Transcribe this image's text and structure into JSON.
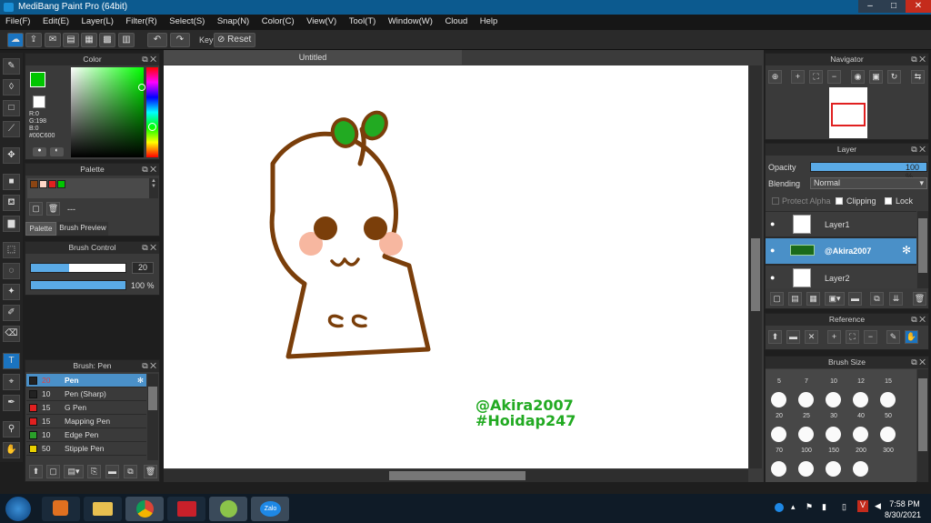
{
  "window": {
    "title": "MediBang Paint Pro (64bit)",
    "minimize": "–",
    "maximize": "□",
    "close": "✕"
  },
  "menu": [
    "File(F)",
    "Edit(E)",
    "Layer(L)",
    "Filter(R)",
    "Select(S)",
    "Snap(N)",
    "Color(C)",
    "View(V)",
    "Tool(T)",
    "Window(W)",
    "Cloud",
    "Help"
  ],
  "toolbar": {
    "key_label": "Key",
    "reset_label": "Reset"
  },
  "color_panel": {
    "title": "Color",
    "r": "R:0",
    "g": "G:198",
    "b": "B:0",
    "hex": "#00C600",
    "current": "#00c600"
  },
  "palette_panel": {
    "title": "Palette",
    "colors": [
      "#8b4513",
      "#ffd7c7",
      "#e02020",
      "#00c600"
    ],
    "entry": "---",
    "tab_palette": "Palette",
    "tab_preview": "Brush Preview"
  },
  "brush_control": {
    "title": "Brush Control",
    "size": "20",
    "opacity": "100 %",
    "size_fraction": 0.4,
    "opacity_fraction": 1.0
  },
  "brush_list": {
    "title": "Brush: Pen",
    "items": [
      {
        "size": "20",
        "name": "Pen",
        "color": "#222222",
        "selected": true
      },
      {
        "size": "10",
        "name": "Pen (Sharp)",
        "color": "#222222"
      },
      {
        "size": "15",
        "name": "G Pen",
        "color": "#e02020"
      },
      {
        "size": "15",
        "name": "Mapping Pen",
        "color": "#e02020"
      },
      {
        "size": "10",
        "name": "Edge Pen",
        "color": "#2aa02a"
      },
      {
        "size": "50",
        "name": "Stipple Pen",
        "color": "#e8d000"
      }
    ]
  },
  "document": {
    "tab": "Untitled",
    "watermark_1": "@Akira2007",
    "watermark_2": "#Hoidap247"
  },
  "navigator": {
    "title": "Navigator"
  },
  "layer_panel": {
    "title": "Layer",
    "opacity_label": "Opacity",
    "opacity_value": "100 %",
    "blending_label": "Blending",
    "blending_value": "Normal",
    "protect_alpha": "Protect Alpha",
    "clipping": "Clipping",
    "lock": "Lock",
    "layers": [
      {
        "name": "Layer1",
        "selected": false
      },
      {
        "name": "@Akira2007",
        "selected": true
      },
      {
        "name": "Layer2",
        "selected": false
      }
    ]
  },
  "reference_panel": {
    "title": "Reference"
  },
  "brush_size_panel": {
    "title": "Brush Size",
    "top_row": [
      "5",
      "7",
      "10",
      "12",
      "15"
    ],
    "row2": [
      "20",
      "25",
      "30",
      "40",
      "50"
    ],
    "row3": [
      "70",
      "100",
      "150",
      "200",
      "300"
    ]
  },
  "taskbar": {
    "time": "7:58 PM",
    "date": "8/30/2021",
    "zalo": "Zalo"
  },
  "colors": {
    "accent": "#4a9ad6",
    "selected_row": "#4a90c8",
    "brown": "#7a3e0a",
    "green": "#22aa22",
    "blush": "#f7b7a0"
  }
}
